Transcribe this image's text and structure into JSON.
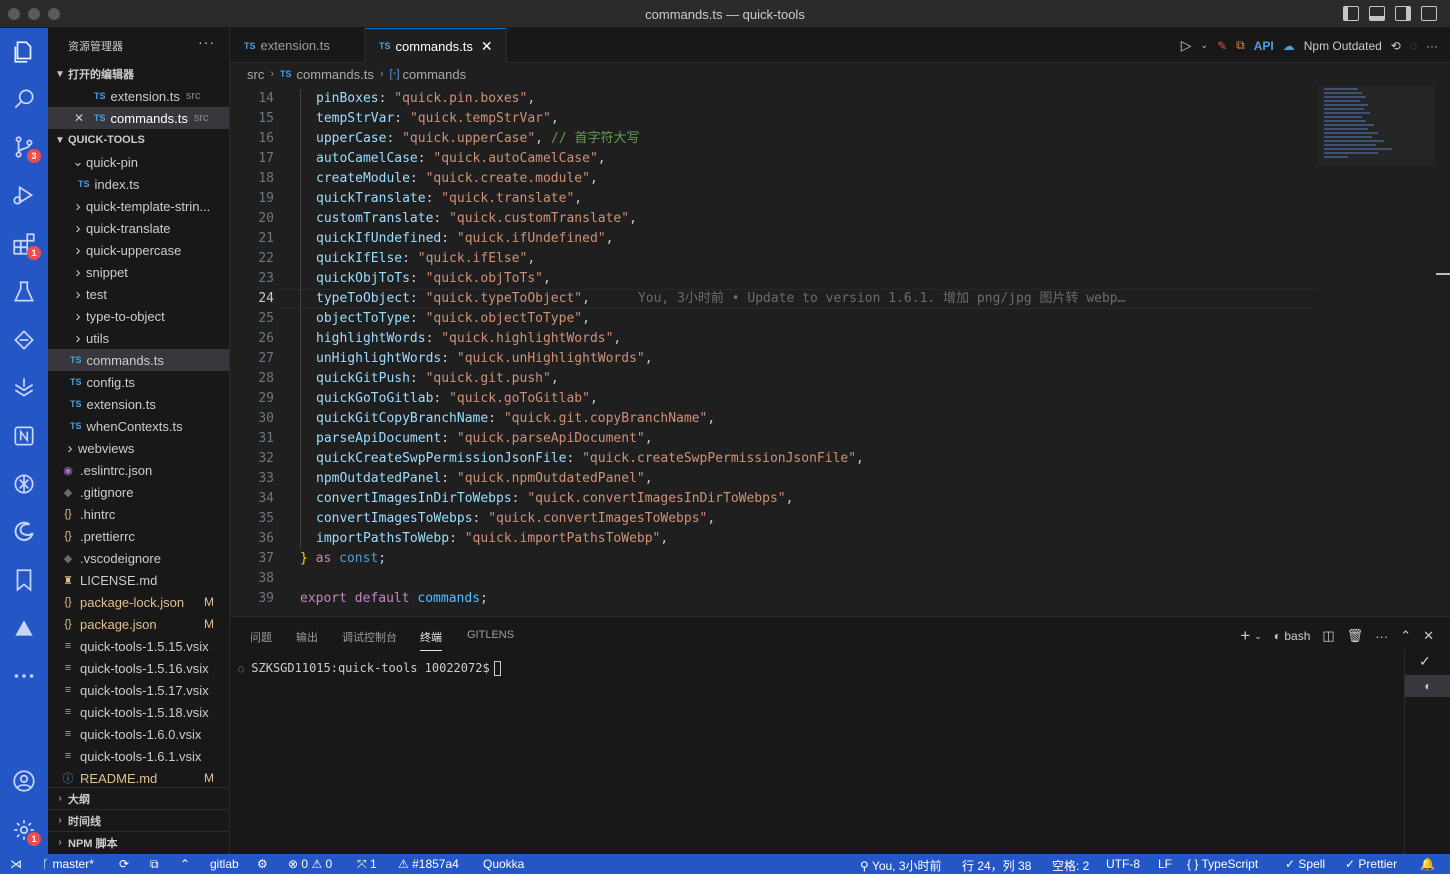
{
  "window": {
    "title": "commands.ts — quick-tools"
  },
  "activity": {
    "scm_badge": "3",
    "extensions_badge": "1",
    "settings_badge": "1"
  },
  "sidebar": {
    "title": "资源管理器",
    "open_editors_header": "打开的编辑器",
    "open_editors": [
      {
        "name": "extension.ts",
        "desc": "src"
      },
      {
        "name": "commands.ts",
        "desc": "src"
      }
    ],
    "project_header": "QUICK-TOOLS",
    "tree": [
      {
        "name": "quick-pin",
        "kind": "folder-open"
      },
      {
        "name": "index.ts",
        "kind": "ts"
      },
      {
        "name": "quick-template-strin...",
        "kind": "folder"
      },
      {
        "name": "quick-translate",
        "kind": "folder"
      },
      {
        "name": "quick-uppercase",
        "kind": "folder"
      },
      {
        "name": "snippet",
        "kind": "folder"
      },
      {
        "name": "test",
        "kind": "folder"
      },
      {
        "name": "type-to-object",
        "kind": "folder"
      },
      {
        "name": "utils",
        "kind": "folder"
      },
      {
        "name": "commands.ts",
        "kind": "ts"
      },
      {
        "name": "config.ts",
        "kind": "ts"
      },
      {
        "name": "extension.ts",
        "kind": "ts"
      },
      {
        "name": "whenContexts.ts",
        "kind": "ts"
      },
      {
        "name": "webviews",
        "kind": "folder"
      },
      {
        "name": ".eslintrc.json",
        "kind": "eslint"
      },
      {
        "name": ".gitignore",
        "kind": "git"
      },
      {
        "name": ".hintrc",
        "kind": "json"
      },
      {
        "name": ".prettierrc",
        "kind": "json"
      },
      {
        "name": ".vscodeignore",
        "kind": "vscode"
      },
      {
        "name": "LICENSE.md",
        "kind": "license"
      },
      {
        "name": "package-lock.json",
        "kind": "json",
        "mark": "M"
      },
      {
        "name": "package.json",
        "kind": "json",
        "mark": "M"
      },
      {
        "name": "quick-tools-1.5.15.vsix",
        "kind": "file"
      },
      {
        "name": "quick-tools-1.5.16.vsix",
        "kind": "file"
      },
      {
        "name": "quick-tools-1.5.17.vsix",
        "kind": "file"
      },
      {
        "name": "quick-tools-1.5.18.vsix",
        "kind": "file"
      },
      {
        "name": "quick-tools-1.6.0.vsix",
        "kind": "file"
      },
      {
        "name": "quick-tools-1.6.1.vsix",
        "kind": "file"
      },
      {
        "name": "README.md",
        "kind": "info",
        "mark": "M"
      }
    ],
    "outline": "大纲",
    "timeline": "时间线",
    "npm_scripts": "NPM 脚本"
  },
  "tabs": [
    {
      "label": "extension.ts",
      "lang": "TS"
    },
    {
      "label": "commands.ts",
      "lang": "TS"
    }
  ],
  "editor_actions": {
    "npm_outdated": "Npm Outdated",
    "api": "API"
  },
  "breadcrumb": {
    "folder": "src",
    "file": "commands.ts",
    "symbol": "commands"
  },
  "code": [
    {
      "n": "14",
      "key": "pinBoxes",
      "val": "\"quick.pin.boxes\""
    },
    {
      "n": "15",
      "key": "tempStrVar",
      "val": "\"quick.tempStrVar\""
    },
    {
      "n": "16",
      "key": "upperCase",
      "val": "\"quick.upperCase\"",
      "comment": "// 首字符大写"
    },
    {
      "n": "17",
      "key": "autoCamelCase",
      "val": "\"quick.autoCamelCase\""
    },
    {
      "n": "18",
      "key": "createModule",
      "val": "\"quick.create.module\""
    },
    {
      "n": "19",
      "key": "quickTranslate",
      "val": "\"quick.translate\""
    },
    {
      "n": "20",
      "key": "customTranslate",
      "val": "\"quick.customTranslate\""
    },
    {
      "n": "21",
      "key": "quickIfUndefined",
      "val": "\"quick.ifUndefined\""
    },
    {
      "n": "22",
      "key": "quickIfElse",
      "val": "\"quick.ifElse\""
    },
    {
      "n": "23",
      "key": "quickObjToTs",
      "val": "\"quick.objToTs\""
    },
    {
      "n": "24",
      "key": "typeToObject",
      "val": "\"quick.typeToObject\"",
      "blame": "You, 3小时前 • Update to version 1.6.1. 增加 png/jpg 图片转 webp…"
    },
    {
      "n": "25",
      "key": "objectToType",
      "val": "\"quick.objectToType\""
    },
    {
      "n": "26",
      "key": "highlightWords",
      "val": "\"quick.highlightWords\""
    },
    {
      "n": "27",
      "key": "unHighlightWords",
      "val": "\"quick.unHighlightWords\""
    },
    {
      "n": "28",
      "key": "quickGitPush",
      "val": "\"quick.git.push\""
    },
    {
      "n": "29",
      "key": "quickGoToGitlab",
      "val": "\"quick.goToGitlab\""
    },
    {
      "n": "30",
      "key": "quickGitCopyBranchName",
      "val": "\"quick.git.copyBranchName\""
    },
    {
      "n": "31",
      "key": "parseApiDocument",
      "val": "\"quick.parseApiDocument\""
    },
    {
      "n": "32",
      "key": "quickCreateSwpPermissionJsonFile",
      "val": "\"quick.createSwpPermissionJsonFile\""
    },
    {
      "n": "33",
      "key": "npmOutdatedPanel",
      "val": "\"quick.npmOutdatedPanel\""
    },
    {
      "n": "34",
      "key": "convertImagesInDirToWebps",
      "val": "\"quick.convertImagesInDirToWebps\""
    },
    {
      "n": "35",
      "key": "convertImagesToWebps",
      "val": "\"quick.convertImagesToWebps\""
    },
    {
      "n": "36",
      "key": "importPathsToWebp",
      "val": "\"quick.importPathsToWebp\""
    }
  ],
  "code_tail": {
    "l37_num": "37",
    "l37_brace": "}",
    "l37_as": "as",
    "l37_const": "const",
    "l37_semi": ";",
    "l38_num": "38",
    "l39_num": "39",
    "l39_export": "export default",
    "l39_ident": "commands",
    "l39_semi": ";"
  },
  "cursor_line": "24",
  "panel": {
    "tabs": [
      "问题",
      "输出",
      "调试控制台",
      "终端",
      "GITLENS"
    ],
    "active_tab": "终端",
    "shell": "bash",
    "prompt": "SZKSGD11015:quick-tools 10022072$"
  },
  "statusbar": {
    "branch": "master*",
    "gitlab": "gitlab",
    "errors": "0",
    "warnings": "0",
    "ports": "1",
    "commit": "#1857a4",
    "quokka": "Quokka",
    "blame": "You, 3小时前",
    "position": "行 24，列 38",
    "spaces": "空格: 2",
    "encoding": "UTF-8",
    "eol": "LF",
    "language": "TypeScript",
    "spell": "Spell",
    "prettier": "Prettier"
  },
  "colors": {
    "activity": "#2456c6",
    "status": "#2456c6",
    "editor_bg": "#1f1f1f",
    "string": "#ce9178",
    "property": "#9cdcfe"
  }
}
